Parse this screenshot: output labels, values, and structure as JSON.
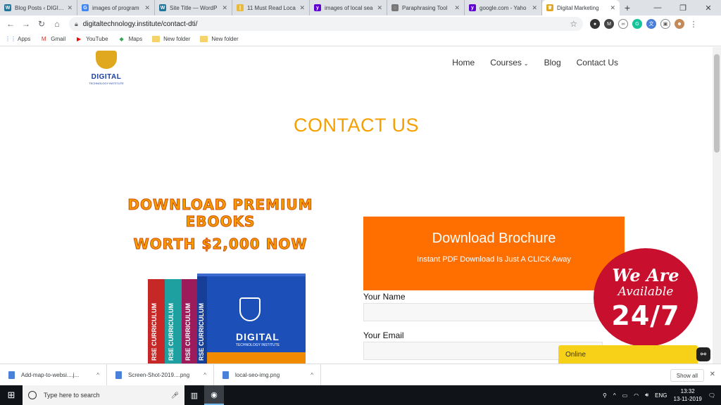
{
  "browser": {
    "tabs": [
      {
        "title": "Blog Posts ‹ DIGITA",
        "icon": "wordpress-icon",
        "color": "#21759b",
        "glyph": "W"
      },
      {
        "title": "images of program",
        "icon": "google-icon",
        "color": "#4285f4",
        "glyph": "G"
      },
      {
        "title": "Site Title — WordP",
        "icon": "wordpress-icon",
        "color": "#21759b",
        "glyph": "W"
      },
      {
        "title": "11 Must Read Loca",
        "icon": "page-icon",
        "color": "#e8b93a",
        "glyph": "|"
      },
      {
        "title": "images of local sea",
        "icon": "yahoo-icon",
        "color": "#5f01d1",
        "glyph": "y"
      },
      {
        "title": "Paraphrasing Tool",
        "icon": "tool-icon",
        "color": "#777777",
        "glyph": "◌"
      },
      {
        "title": "google.com - Yaho",
        "icon": "yahoo-icon",
        "color": "#5f01d1",
        "glyph": "y"
      },
      {
        "title": "Digital Marketing",
        "icon": "trophy-icon",
        "color": "#e0a81e",
        "glyph": "♛"
      }
    ],
    "url": "digitaltechnology.institute/contact-dti/",
    "bookmarks": [
      {
        "label": "Apps",
        "icon": "apps-icon",
        "glyph": "⋮⋮",
        "color": "#1a73e8"
      },
      {
        "label": "Gmail",
        "icon": "gmail-icon",
        "glyph": "M",
        "color": "#d93025"
      },
      {
        "label": "YouTube",
        "icon": "youtube-icon",
        "glyph": "▶",
        "color": "#ff0000"
      },
      {
        "label": "Maps",
        "icon": "maps-icon",
        "glyph": "◆",
        "color": "#34a853"
      },
      {
        "label": "New folder",
        "icon": "folder-icon",
        "glyph": "",
        "color": "#f5d36b"
      },
      {
        "label": "New folder",
        "icon": "folder-icon",
        "glyph": "",
        "color": "#f5d36b"
      }
    ]
  },
  "site": {
    "logo_text": "DIGITAL",
    "logo_sub": "TECHNOLOGY INSTITUTE",
    "nav": {
      "home": "Home",
      "courses": "Courses",
      "blog": "Blog",
      "contact": "Contact Us"
    },
    "page_title": "CONTACT US",
    "promo_line1": "DOWNLOAD PREMIUM EBOOKS",
    "promo_line2": "WORTH $2,000 NOW",
    "book_spine": "RSE CURRICULUM",
    "brochure": {
      "heading": "Download Brochure",
      "sub": "Instant PDF Download Is Just A CLICK Away"
    },
    "form": {
      "name_label": "Your Name",
      "email_label": "Your Email"
    },
    "badge": {
      "line1": "We Are",
      "line2": "Available",
      "line3": "24/7"
    },
    "chat_status": "Online"
  },
  "downloads": {
    "items": [
      {
        "name": "Add-map-to-websi....j..."
      },
      {
        "name": "Screen-Shot-2019....png"
      },
      {
        "name": "local-seo-img.png"
      }
    ],
    "show_all": "Show all"
  },
  "taskbar": {
    "search_placeholder": "Type here to search",
    "language": "ENG",
    "time": "13:32",
    "date": "13-11-2019"
  }
}
